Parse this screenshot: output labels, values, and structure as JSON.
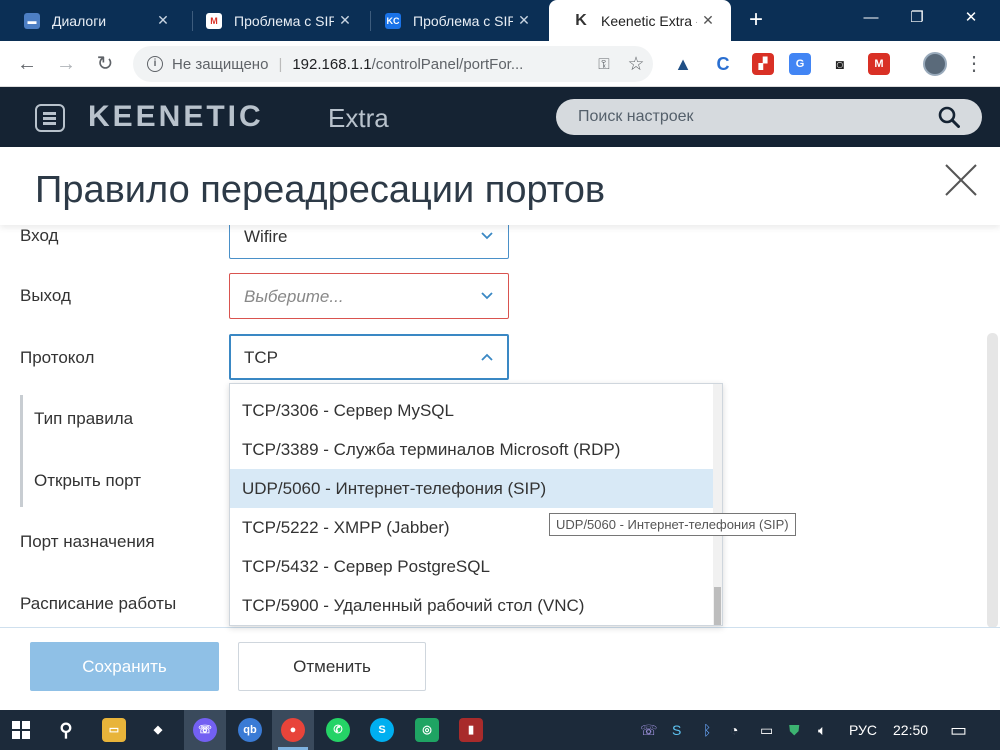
{
  "browser": {
    "tabs": [
      {
        "title": "Диалоги",
        "icon": "chat-icon",
        "color": "#4d7fc4",
        "active": false
      },
      {
        "title": "Проблема с SIP",
        "icon": "gmail-icon",
        "color": "#d93025",
        "active": false
      },
      {
        "title": "Проблема с SIP",
        "icon": "kc-icon",
        "color": "#1a73e8",
        "active": false
      },
      {
        "title": "Keenetic Extra -",
        "icon": "keenetic-icon",
        "color": "#333333",
        "active": true
      }
    ],
    "address": {
      "security_label": "Не защищено",
      "host": "192.168.1.1",
      "path": "/controlPanel/portFor..."
    }
  },
  "app": {
    "brand": "KEENETIC",
    "model": "Extra",
    "search_placeholder": "Поиск настроек"
  },
  "page": {
    "title": "Правило переадресации портов"
  },
  "form": {
    "input_label": "Вход",
    "input_value": "Wifire",
    "output_label": "Выход",
    "output_placeholder": "Выберите...",
    "protocol_label": "Протокол",
    "protocol_value": "TCP",
    "rule_type_label": "Тип правила",
    "open_port_label": "Открыть порт",
    "dest_port_label": "Порт назначения",
    "schedule_label": "Расписание работы"
  },
  "dropdown": {
    "items": [
      "TCP/3306 - Сервер MySQL",
      "TCP/3389 - Служба терминалов Microsoft (RDP)",
      "UDP/5060 - Интернет-телефония (SIP)",
      "TCP/5222 - XMPP (Jabber)",
      "TCP/5432 - Сервер PostgreSQL",
      "TCP/5900 - Удаленный рабочий стол (VNC)"
    ],
    "highlighted_index": 2,
    "tooltip": "UDP/5060 - Интернет-телефония (SIP)"
  },
  "footer": {
    "save_label": "Сохранить",
    "cancel_label": "Отменить"
  },
  "taskbar": {
    "language": "РУС",
    "time": "22:50"
  },
  "colors": {
    "accent": "#3a88c4",
    "error": "#d9534f",
    "header_bg": "#152333",
    "tab_strip_bg": "#0b2f55"
  }
}
